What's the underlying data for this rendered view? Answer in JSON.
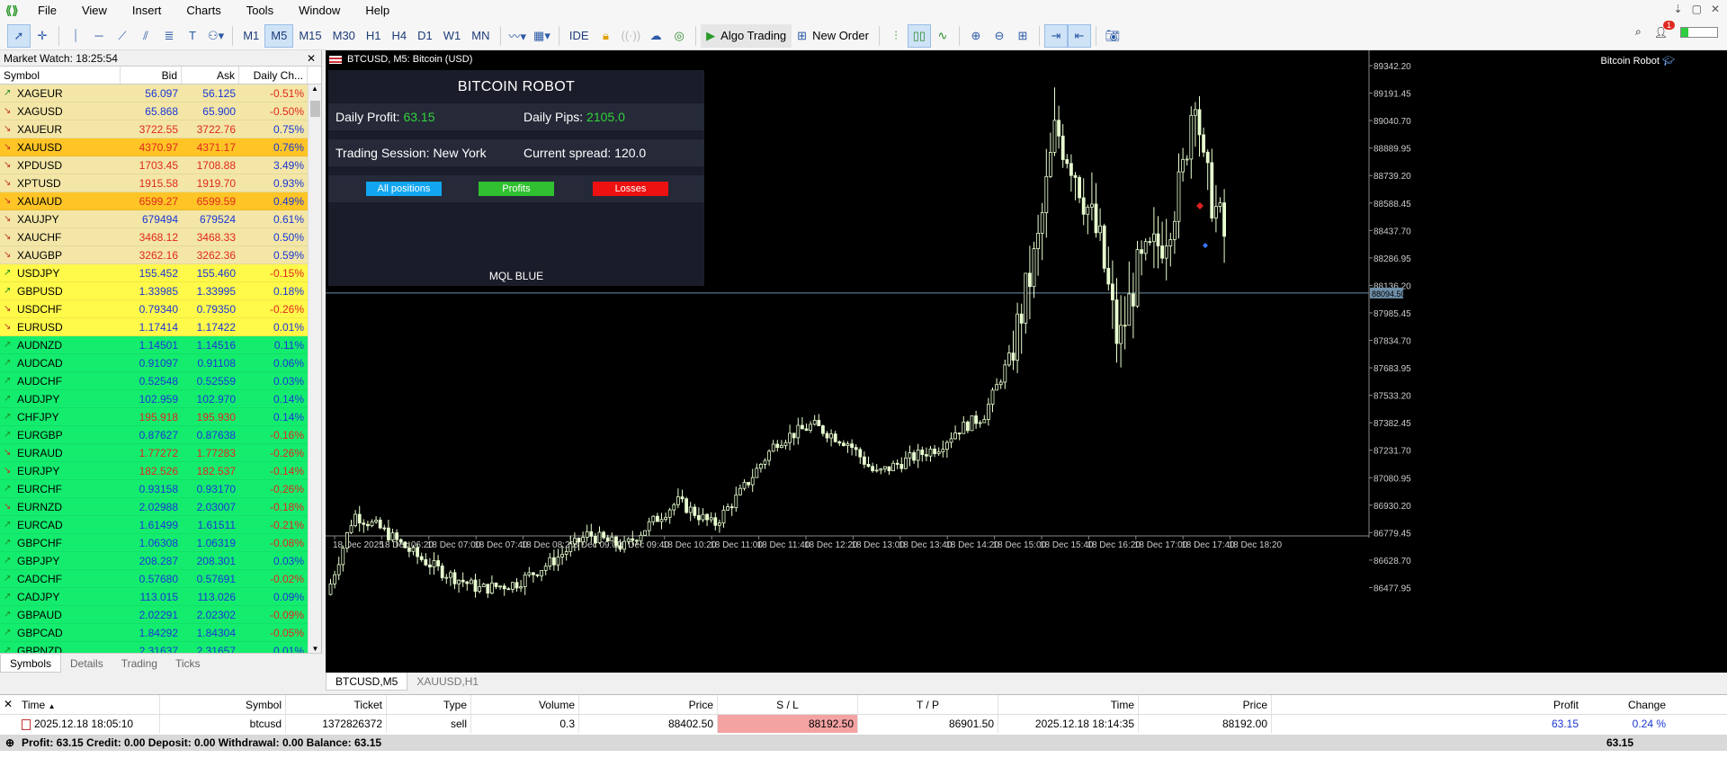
{
  "menu": [
    "File",
    "View",
    "Insert",
    "Charts",
    "Tools",
    "Window",
    "Help"
  ],
  "timeframes": [
    "M1",
    "M5",
    "M15",
    "M30",
    "H1",
    "H4",
    "D1",
    "W1",
    "MN"
  ],
  "toolbar": {
    "ide": "IDE",
    "algo": "Algo Trading",
    "new_order": "New Order",
    "notif_count": "1"
  },
  "market_watch": {
    "title": "Market Watch: 18:25:54",
    "headers": [
      "Symbol",
      "Bid",
      "Ask",
      "Daily Ch..."
    ],
    "tabs": [
      "Symbols",
      "Details",
      "Trading",
      "Ticks"
    ],
    "rows": [
      {
        "sym": "XAGEUR",
        "dir": "up",
        "bid": "56.097",
        "ask": "56.125",
        "chg": "-0.51%",
        "bg": "#f3e6a6",
        "color": "blue"
      },
      {
        "sym": "XAGUSD",
        "dir": "dn",
        "bid": "65.868",
        "ask": "65.900",
        "chg": "-0.50%",
        "bg": "#f3e6a6",
        "color": "blue"
      },
      {
        "sym": "XAUEUR",
        "dir": "dn",
        "bid": "3722.55",
        "ask": "3722.76",
        "chg": "0.75%",
        "bg": "#f3e6a6",
        "color": "red"
      },
      {
        "sym": "XAUUSD",
        "dir": "dn",
        "bid": "4370.97",
        "ask": "4371.17",
        "chg": "0.76%",
        "bg": "#ffc526",
        "color": "red"
      },
      {
        "sym": "XPDUSD",
        "dir": "dn",
        "bid": "1703.45",
        "ask": "1708.88",
        "chg": "3.49%",
        "bg": "#f3e6a6",
        "color": "red"
      },
      {
        "sym": "XPTUSD",
        "dir": "dn",
        "bid": "1915.58",
        "ask": "1919.70",
        "chg": "0.93%",
        "bg": "#f3e6a6",
        "color": "red"
      },
      {
        "sym": "XAUAUD",
        "dir": "dn",
        "bid": "6599.27",
        "ask": "6599.59",
        "chg": "0.49%",
        "bg": "#ffc526",
        "color": "red"
      },
      {
        "sym": "XAUJPY",
        "dir": "dn",
        "bid": "679494",
        "ask": "679524",
        "chg": "0.61%",
        "bg": "#f3e6a6",
        "color": "blue"
      },
      {
        "sym": "XAUCHF",
        "dir": "dn",
        "bid": "3468.12",
        "ask": "3468.33",
        "chg": "0.50%",
        "bg": "#f3e6a6",
        "color": "red"
      },
      {
        "sym": "XAUGBP",
        "dir": "dn",
        "bid": "3262.16",
        "ask": "3262.36",
        "chg": "0.59%",
        "bg": "#f3e6a6",
        "color": "red"
      },
      {
        "sym": "USDJPY",
        "dir": "up",
        "bid": "155.452",
        "ask": "155.460",
        "chg": "-0.15%",
        "bg": "#fff94a",
        "color": "blue"
      },
      {
        "sym": "GBPUSD",
        "dir": "up",
        "bid": "1.33985",
        "ask": "1.33995",
        "chg": "0.18%",
        "bg": "#fff94a",
        "color": "blue"
      },
      {
        "sym": "USDCHF",
        "dir": "dn",
        "bid": "0.79340",
        "ask": "0.79350",
        "chg": "-0.26%",
        "bg": "#fff94a",
        "color": "blue"
      },
      {
        "sym": "EURUSD",
        "dir": "dn",
        "bid": "1.17414",
        "ask": "1.17422",
        "chg": "0.01%",
        "bg": "#fff94a",
        "color": "blue"
      },
      {
        "sym": "AUDNZD",
        "dir": "up",
        "bid": "1.14501",
        "ask": "1.14516",
        "chg": "0.11%",
        "bg": "#14ec6e",
        "color": "blue"
      },
      {
        "sym": "AUDCAD",
        "dir": "up",
        "bid": "0.91097",
        "ask": "0.91108",
        "chg": "0.06%",
        "bg": "#14ec6e",
        "color": "blue"
      },
      {
        "sym": "AUDCHF",
        "dir": "up",
        "bid": "0.52548",
        "ask": "0.52559",
        "chg": "0.03%",
        "bg": "#14ec6e",
        "color": "blue"
      },
      {
        "sym": "AUDJPY",
        "dir": "up",
        "bid": "102.959",
        "ask": "102.970",
        "chg": "0.14%",
        "bg": "#14ec6e",
        "color": "blue"
      },
      {
        "sym": "CHFJPY",
        "dir": "up",
        "bid": "195.918",
        "ask": "195.930",
        "chg": "0.14%",
        "bg": "#14ec6e",
        "color": "red"
      },
      {
        "sym": "EURGBP",
        "dir": "up",
        "bid": "0.87627",
        "ask": "0.87638",
        "chg": "-0.16%",
        "bg": "#14ec6e",
        "color": "blue"
      },
      {
        "sym": "EURAUD",
        "dir": "dn",
        "bid": "1.77272",
        "ask": "1.77283",
        "chg": "-0.26%",
        "bg": "#14ec6e",
        "color": "red"
      },
      {
        "sym": "EURJPY",
        "dir": "dn",
        "bid": "182.526",
        "ask": "182.537",
        "chg": "-0.14%",
        "bg": "#14ec6e",
        "color": "red"
      },
      {
        "sym": "EURCHF",
        "dir": "up",
        "bid": "0.93158",
        "ask": "0.93170",
        "chg": "-0.26%",
        "bg": "#14ec6e",
        "color": "blue"
      },
      {
        "sym": "EURNZD",
        "dir": "dn",
        "bid": "2.02988",
        "ask": "2.03007",
        "chg": "-0.18%",
        "bg": "#14ec6e",
        "color": "blue"
      },
      {
        "sym": "EURCAD",
        "dir": "up",
        "bid": "1.61499",
        "ask": "1.61511",
        "chg": "-0.21%",
        "bg": "#14ec6e",
        "color": "blue"
      },
      {
        "sym": "GBPCHF",
        "dir": "up",
        "bid": "1.06308",
        "ask": "1.06319",
        "chg": "-0.08%",
        "bg": "#14ec6e",
        "color": "blue"
      },
      {
        "sym": "GBPJPY",
        "dir": "up",
        "bid": "208.287",
        "ask": "208.301",
        "chg": "0.03%",
        "bg": "#14ec6e",
        "color": "blue"
      },
      {
        "sym": "CADCHF",
        "dir": "up",
        "bid": "0.57680",
        "ask": "0.57691",
        "chg": "-0.02%",
        "bg": "#14ec6e",
        "color": "blue"
      },
      {
        "sym": "CADJPY",
        "dir": "up",
        "bid": "113.015",
        "ask": "113.026",
        "chg": "0.09%",
        "bg": "#14ec6e",
        "color": "blue"
      },
      {
        "sym": "GBPAUD",
        "dir": "up",
        "bid": "2.02291",
        "ask": "2.02302",
        "chg": "-0.09%",
        "bg": "#14ec6e",
        "color": "blue"
      },
      {
        "sym": "GBPCAD",
        "dir": "up",
        "bid": "1.84292",
        "ask": "1.84304",
        "chg": "-0.05%",
        "bg": "#14ec6e",
        "color": "blue"
      },
      {
        "sym": "GBPNZD",
        "dir": "up",
        "bid": "2.31637",
        "ask": "2.31657",
        "chg": "0.01%",
        "bg": "#14ec6e",
        "color": "blue"
      }
    ]
  },
  "chart": {
    "title": "BTCUSD, M5:  Bitcoin (USD)",
    "robot_label": "Bitcoin Robot",
    "current_price": "88094.50",
    "price_labels": [
      "89342.20",
      "89191.45",
      "89040.70",
      "88889.95",
      "88739.20",
      "88588.45",
      "88437.70",
      "88286.95",
      "88136.20",
      "87985.45",
      "87834.70",
      "87683.95",
      "87533.20",
      "87382.45",
      "87231.70",
      "87080.95",
      "86930.20",
      "86779.45",
      "86628.70",
      "86477.95"
    ],
    "time_labels": [
      "18 Dec 2025",
      "18 Dec 06:20",
      "18 Dec 07:00",
      "18 Dec 07:40",
      "18 Dec 08:20",
      "18 Dec 09:00",
      "18 Dec 09:40",
      "18 Dec 10:20",
      "18 Dec 11:00",
      "18 Dec 11:40",
      "18 Dec 12:20",
      "18 Dec 13:00",
      "18 Dec 13:40",
      "18 Dec 14:20",
      "18 Dec 15:00",
      "18 Dec 15:40",
      "18 Dec 16:20",
      "18 Dec 17:00",
      "18 Dec 17:40",
      "18 Dec 18:20"
    ],
    "tabs": [
      "BTCUSD,M5",
      "XAUUSD,H1"
    ]
  },
  "panel": {
    "title": "BITCOIN ROBOT",
    "daily_profit_label": "Daily Profit:",
    "daily_profit": "63.15",
    "daily_pips_label": "Daily Pips:",
    "daily_pips": "2105.0",
    "session_label": "Trading Session:",
    "session": "New York",
    "spread_label": "Current spread:",
    "spread": "120.0",
    "btn_all": "All positions",
    "btn_profits": "Profits",
    "btn_losses": "Losses",
    "footer": "MQL BLUE"
  },
  "trade": {
    "headers": [
      "Time",
      "Symbol",
      "Ticket",
      "Type",
      "Volume",
      "Price",
      "S / L",
      "T / P",
      "Time",
      "Price",
      "Profit",
      "Change"
    ],
    "row": {
      "time": "2025.12.18 18:05:10",
      "symbol": "btcusd",
      "ticket": "1372826372",
      "type": "sell",
      "volume": "0.3",
      "price": "88402.50",
      "sl": "88192.50",
      "tp": "86901.50",
      "time2": "2025.12.18 18:14:35",
      "price2": "88192.00",
      "profit": "63.15",
      "change": "0.24 %"
    },
    "footer": "Profit: 63.15  Credit: 0.00  Deposit: 0.00  Withdrawal: 0.00  Balance: 63.15",
    "footer_total": "63.15"
  }
}
